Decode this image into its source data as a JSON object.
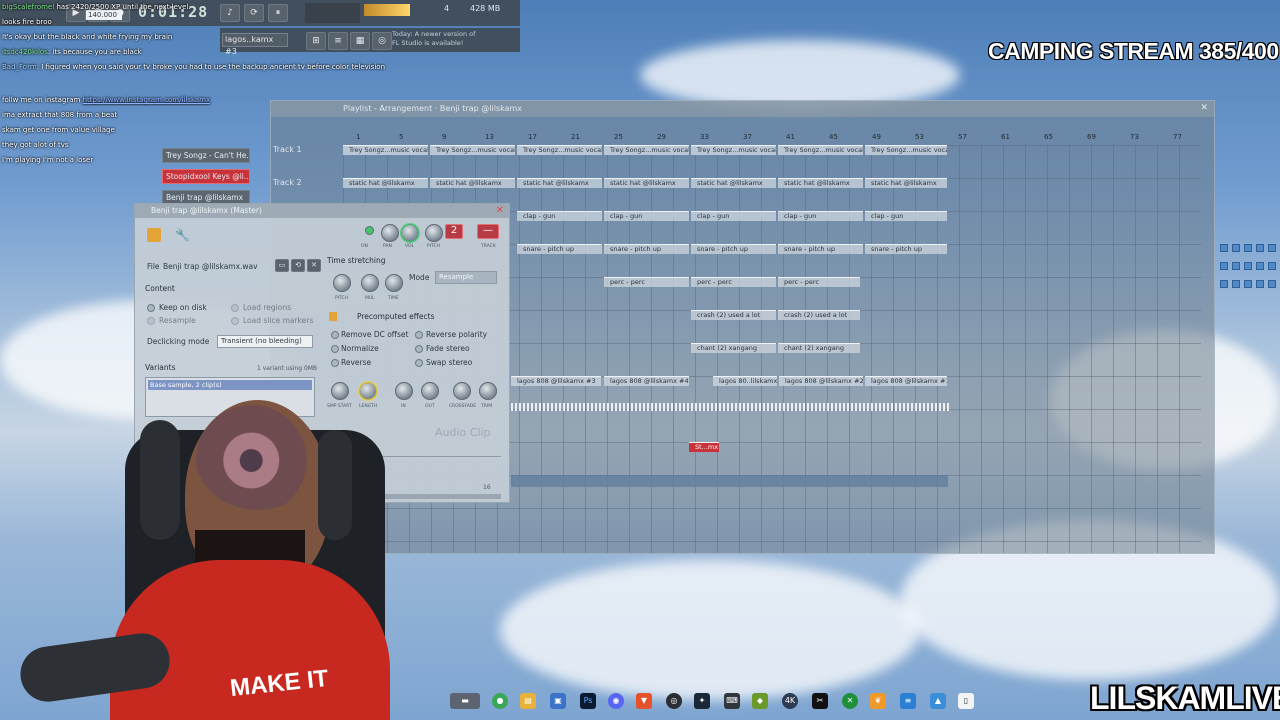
{
  "chat": [
    {
      "user": "bigScalefromel",
      "text": "has 2420/2500 XP until the next level."
    },
    {
      "user": "",
      "text": "looks fire broo"
    },
    {
      "user": "",
      "text": "It's okay but the black and white frying my brain"
    },
    {
      "user": "itsdc420kilos",
      "text": "its because you are black"
    },
    {
      "user": "Bad_Form",
      "text": "I figured when you said your tv broke you had to use the backup ancient tv before color television"
    },
    {
      "user": "",
      "text": "follw me on instagram"
    },
    {
      "user": "",
      "text": "ima extract that 808 from a beat"
    },
    {
      "user": "",
      "text": "skam get one from value village"
    },
    {
      "user": "",
      "text": "they got alot of tvs"
    },
    {
      "user": "",
      "text": "I'm playing I'm not a loser"
    }
  ],
  "instagram_link": "https://www.instagram.com/lilskamx",
  "transport": {
    "time": "0:01:28",
    "tempo": "140.000",
    "memory": "428 MB",
    "cpu_top": "4",
    "cpu_bottom": "9",
    "pattern_name": "lagos..kamx #3",
    "update_hint": "Today: A newer version of FL Studio is available!"
  },
  "overlay": {
    "camping": "CAMPING STREAM 385/400",
    "brand": "LILSKAMLIVE",
    "shirt": "MAKE IT"
  },
  "playlist": {
    "title": "Playlist - Arrangement · Benji trap @lilskamx",
    "ruler": [
      "1",
      "5",
      "9",
      "13",
      "17",
      "21",
      "25",
      "29",
      "33",
      "37",
      "41",
      "45",
      "49",
      "53",
      "57",
      "61",
      "65",
      "69",
      "73",
      "77"
    ],
    "tracks": [
      "Track 1",
      "Track 2"
    ],
    "clips_row1": "Trey Songz...music vocals",
    "clips_row2": "static hat @lilskamx",
    "clips_row3": "clap - gun",
    "clips_row4": "snare - pitch up",
    "clips_row5": "perc - perc",
    "clips_row6": "crash (2) used a lot",
    "clips_row7": "chant (2) xangang",
    "clips_row8a": "lagos 808 @lilskamx #3",
    "clips_row8b": "lagos 808 @lilskamx #4",
    "clips_row8c": "lagos 80..lilskamx",
    "clips_row8d": "lagos 808 @lilskamx #2",
    "clips_row8e": "lagos 808 @lilskamx #1",
    "clip_red": "St...mx"
  },
  "channels": [
    {
      "name": "Trey Songz - Can't He...",
      "color": "gray"
    },
    {
      "name": "Stoopidxool Keys @li...",
      "color": "red"
    },
    {
      "name": "Benji trap @lilskamx",
      "color": "gray"
    }
  ],
  "audio_clip": {
    "title": "Benji trap @lilskamx (Master)",
    "file_label": "File",
    "file_value": "Benji trap @lilskamx.wav",
    "content": "Content",
    "keep_on_disk": "Keep on disk",
    "load_regions": "Load regions",
    "resample": "Resample",
    "load_slice_markers": "Load slice markers",
    "declicking_label": "Declicking mode",
    "declicking_value": "Transient (no bleeding)",
    "variants": "Variants",
    "variants_info": "1 variant using 0MB",
    "variant_row": "Base sample, 2 clip(s)",
    "time_stretching": "Time stretching",
    "mode_label": "Mode",
    "mode_value": "Resample",
    "knob_pitch": "PITCH",
    "knob_mul": "MUL",
    "knob_time": "TIME",
    "precomputed": "Precomputed effects",
    "remove_dc": "Remove DC offset",
    "reverse_polarity": "Reverse polarity",
    "normalize": "Normalize",
    "fade_stereo": "Fade stereo",
    "reverse": "Reverse",
    "swap_stereo": "Swap stereo",
    "knob_smp_start": "SMP START",
    "knob_length": "LENGTH",
    "knob_in": "IN",
    "knob_out": "OUT",
    "knob_crossfade": "CROSSFADE",
    "knob_trim": "TRIM",
    "top_on": "ON",
    "top_pan": "PAN",
    "top_vol": "VOL",
    "top_pitch": "PITCH",
    "top_track": "TRACK",
    "track_num": "2",
    "watermark": "Audio Clip",
    "page_num": "16"
  },
  "taskbar_icons": [
    "explorer-icon",
    "chrome-icon",
    "folder-icon",
    "store-icon",
    "photoshop-icon",
    "discord-icon",
    "brave-icon",
    "obs-icon",
    "steam-icon",
    "keyboard-icon",
    "game-icon",
    "4k-icon",
    "capcut-icon",
    "xbox-icon",
    "fl-studio-icon",
    "notepad-icon",
    "photos-icon",
    "file-icon"
  ]
}
